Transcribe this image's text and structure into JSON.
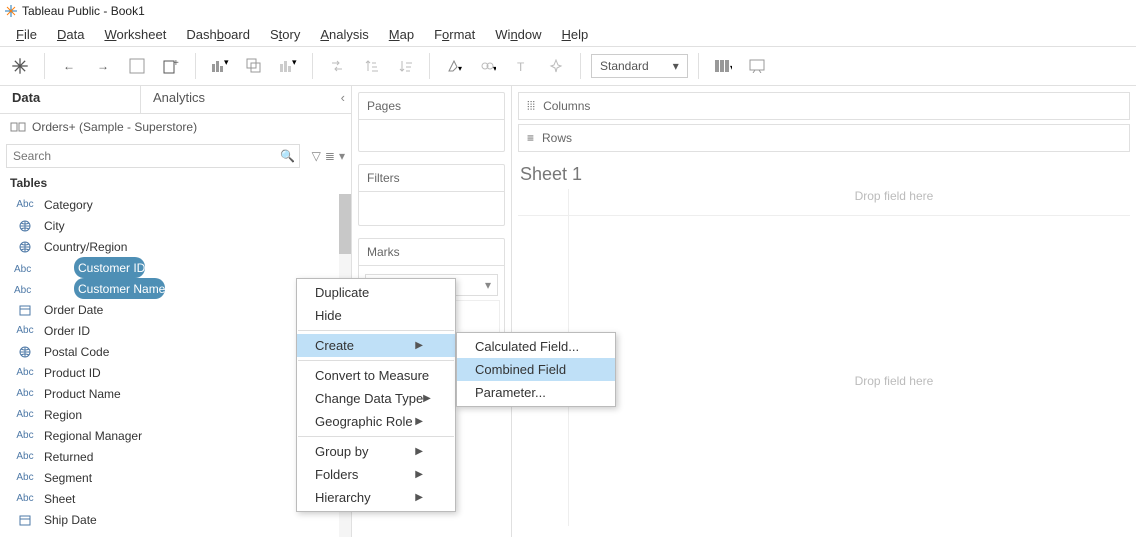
{
  "window": {
    "title": "Tableau Public - Book1"
  },
  "menu": {
    "file": "File",
    "data": "Data",
    "worksheet": "Worksheet",
    "dashboard": "Dashboard",
    "story": "Story",
    "analysis": "Analysis",
    "map": "Map",
    "format": "Format",
    "window": "Window",
    "help": "Help"
  },
  "toolbar": {
    "fit_label": "Standard"
  },
  "data_pane": {
    "tab_data": "Data",
    "tab_analytics": "Analytics",
    "datasource": "Orders+ (Sample - Superstore)",
    "search_placeholder": "Search",
    "tables_label": "Tables"
  },
  "fields": [
    {
      "type": "Abc",
      "label": "Category"
    },
    {
      "type": "globe",
      "label": "City"
    },
    {
      "type": "globe",
      "label": "Country/Region"
    },
    {
      "type": "Abc",
      "label": "Customer ID",
      "selected": true
    },
    {
      "type": "Abc",
      "label": "Customer Name",
      "selected": true
    },
    {
      "type": "date",
      "label": "Order Date"
    },
    {
      "type": "Abc",
      "label": "Order ID"
    },
    {
      "type": "globe",
      "label": "Postal Code"
    },
    {
      "type": "Abc",
      "label": "Product ID"
    },
    {
      "type": "Abc",
      "label": "Product Name"
    },
    {
      "type": "Abc",
      "label": "Region"
    },
    {
      "type": "Abc",
      "label": "Regional Manager"
    },
    {
      "type": "Abc",
      "label": "Returned"
    },
    {
      "type": "Abc",
      "label": "Segment"
    },
    {
      "type": "Abc",
      "label": "Sheet"
    },
    {
      "type": "date",
      "label": "Ship Date"
    }
  ],
  "shelves": {
    "pages": "Pages",
    "filters": "Filters",
    "marks": "Marks",
    "columns": "Columns",
    "rows": "Rows"
  },
  "sheet": {
    "title": "Sheet 1",
    "drop_here": "Drop field here",
    "drop_here2": "Drop\nfield\nhere"
  },
  "context_menu": {
    "duplicate": "Duplicate",
    "hide": "Hide",
    "create": "Create",
    "convert": "Convert to Measure",
    "change_type": "Change Data Type",
    "geo": "Geographic Role",
    "group_by": "Group by",
    "folders": "Folders",
    "hierarchy": "Hierarchy"
  },
  "create_submenu": {
    "calc": "Calculated Field...",
    "combined": "Combined Field",
    "param": "Parameter..."
  }
}
